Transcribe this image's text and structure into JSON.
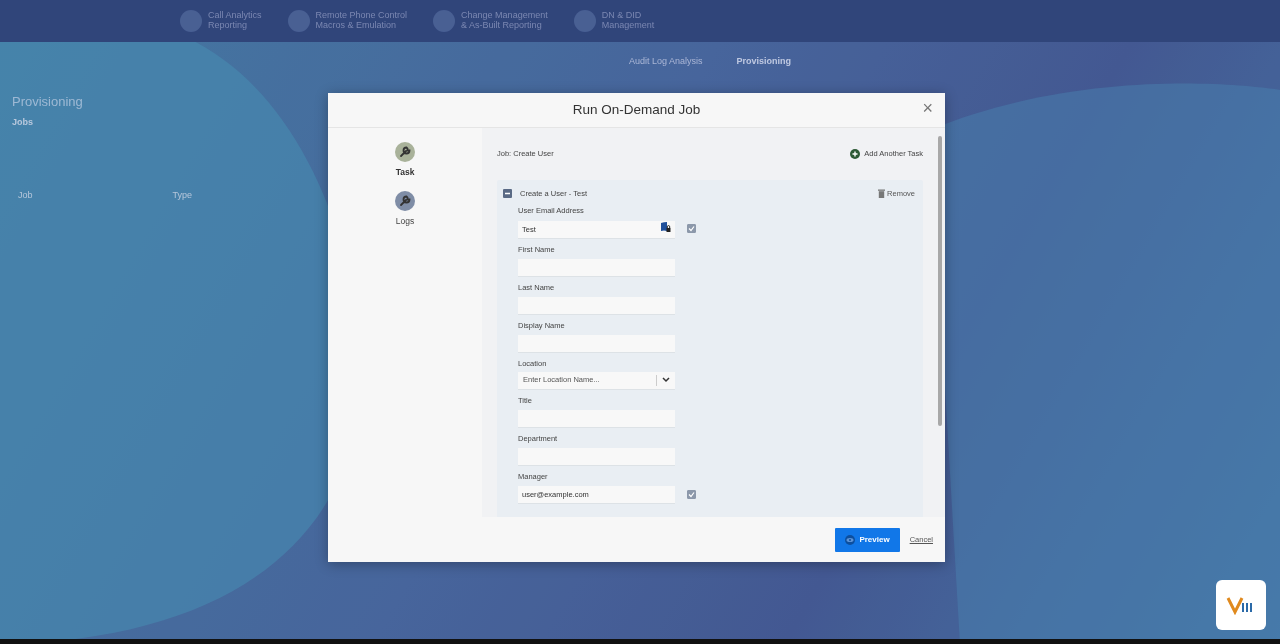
{
  "app_nav": {
    "items": [
      {
        "line1": "Call Analytics",
        "line2": "Reporting"
      },
      {
        "line1": "Remote Phone Control",
        "line2": "Macros & Emulation"
      },
      {
        "line1": "Change Management",
        "line2": "& As-Built Reporting"
      },
      {
        "line1": "DN & DID",
        "line2": "Management"
      }
    ]
  },
  "sub_nav": {
    "links": [
      {
        "label": "Audit Log Analysis",
        "selected": false
      },
      {
        "label": "Provisioning",
        "selected": true
      }
    ]
  },
  "page": {
    "heading": "Provisioning",
    "tabs": [
      {
        "label": "Jobs",
        "selected": true
      }
    ],
    "columns": [
      "Job",
      "Type"
    ]
  },
  "modal": {
    "title": "Run On-Demand Job",
    "close": "×",
    "side_items": [
      {
        "label": "Task",
        "selected": true
      },
      {
        "label": "Logs",
        "selected": false
      }
    ],
    "job_label": "Job: Create User",
    "add_task": "Add Another Task",
    "task": {
      "title": "Create a User - Test",
      "expanded": true,
      "remove": "Remove",
      "fields": [
        {
          "kind": "text",
          "label": "User Email Address",
          "value": "Test",
          "lock": true,
          "checkbox": {
            "checked": true
          }
        },
        {
          "kind": "text",
          "label": "First Name"
        },
        {
          "kind": "text",
          "label": "Last Name"
        },
        {
          "kind": "text",
          "label": "Display Name"
        },
        {
          "kind": "select",
          "label": "Location",
          "placeholder": "Enter Location Name..."
        },
        {
          "kind": "text",
          "label": "Title"
        },
        {
          "kind": "text",
          "label": "Department"
        },
        {
          "kind": "text",
          "label": "Manager",
          "value": "user@example.com",
          "checkbox": {
            "checked": true
          }
        }
      ]
    },
    "preview": "Preview",
    "cancel": "Cancel"
  }
}
